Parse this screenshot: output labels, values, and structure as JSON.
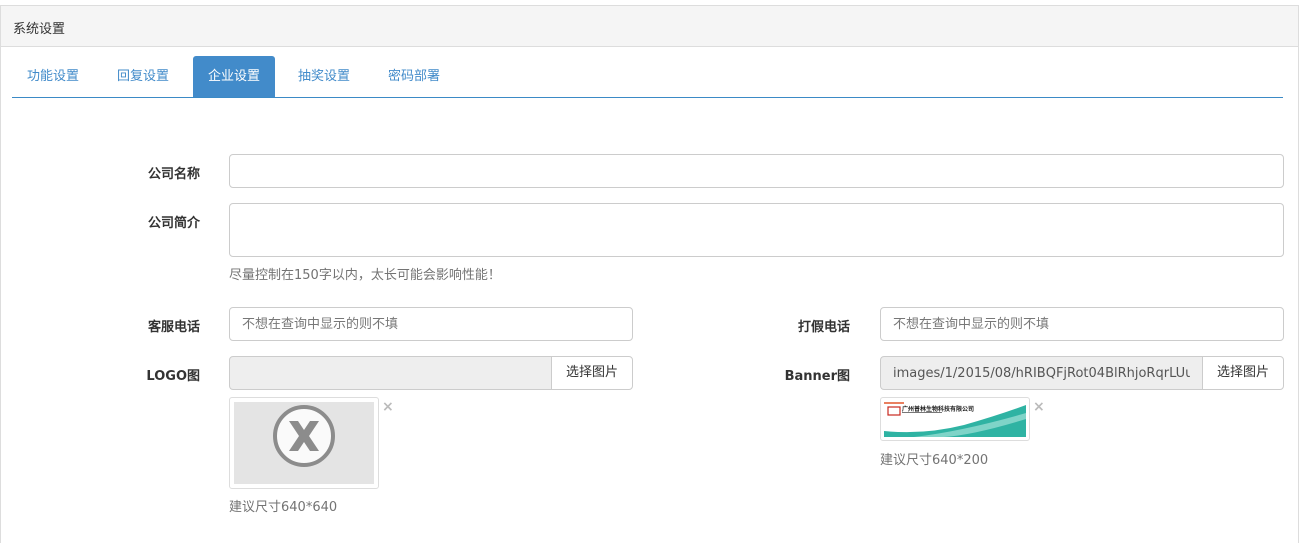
{
  "panel": {
    "title": "系统设置"
  },
  "tabs": [
    {
      "label": "功能设置",
      "active": false
    },
    {
      "label": "回复设置",
      "active": false
    },
    {
      "label": "企业设置",
      "active": true
    },
    {
      "label": "抽奖设置",
      "active": false
    },
    {
      "label": "密码部署",
      "active": false
    }
  ],
  "form": {
    "company_name": {
      "label": "公司名称",
      "value": ""
    },
    "company_intro": {
      "label": "公司简介",
      "value": "",
      "help": "尽量控制在150字以内，太长可能会影响性能！"
    },
    "service_phone": {
      "label": "客服电话",
      "placeholder": "不想在查询中显示的则不填"
    },
    "anti_fake_phone": {
      "label": "打假电话",
      "placeholder": "不想在查询中显示的则不填"
    },
    "logo": {
      "label": "LOGO图",
      "value": "",
      "button": "选择图片",
      "remove": "×",
      "hint": "建议尺寸640*640",
      "icon": "no-image-x-icon"
    },
    "banner": {
      "label": "Banner图",
      "value": "images/1/2015/08/hRIBQFjRot04BlRhjoRqrLUu",
      "button": "选择图片",
      "remove": "×",
      "hint": "建议尺寸640*200",
      "image_text": "广州普林生物科技有限公司"
    }
  },
  "colors": {
    "accent": "#428bca",
    "tab_border": "#3b8ac6",
    "banner_teal": "#2fb3a3"
  }
}
